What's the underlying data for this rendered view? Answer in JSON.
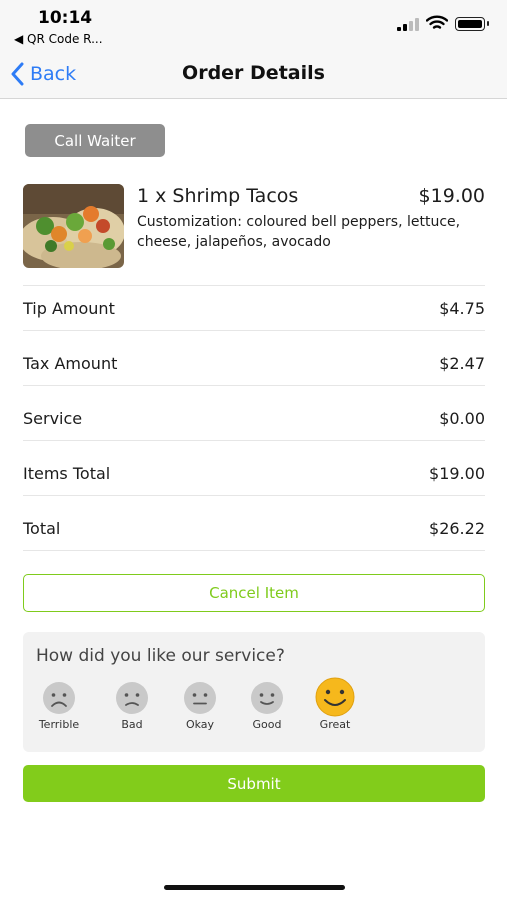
{
  "status_bar": {
    "time": "10:14",
    "back_app": "◀ QR Code R..."
  },
  "nav": {
    "back_label": "Back",
    "title": "Order Details"
  },
  "call_waiter_label": "Call Waiter",
  "item": {
    "name": "1 x Shrimp Tacos",
    "price": "$19.00",
    "customization": "Customization: coloured bell peppers, lettuce, cheese, jalapeños, avocado"
  },
  "summary": [
    {
      "label": "Tip Amount",
      "value": "$4.75"
    },
    {
      "label": "Tax Amount",
      "value": "$2.47"
    },
    {
      "label": "Service",
      "value": "$0.00"
    },
    {
      "label": "Items Total",
      "value": "$19.00"
    },
    {
      "label": "Total",
      "value": "$26.22"
    }
  ],
  "cancel_label": "Cancel Item",
  "feedback": {
    "question": "How did you like our service?",
    "ratings": [
      {
        "label": "Terrible",
        "icon": "terrible-face-icon"
      },
      {
        "label": "Bad",
        "icon": "bad-face-icon"
      },
      {
        "label": "Okay",
        "icon": "okay-face-icon"
      },
      {
        "label": "Good",
        "icon": "good-face-icon"
      },
      {
        "label": "Great",
        "icon": "great-face-icon"
      }
    ],
    "selected": "Great"
  },
  "submit_label": "Submit",
  "colors": {
    "accent_green": "#82cc1b",
    "link_blue": "#2e7cf6",
    "selected_face": "#f6b81c",
    "unselected_face": "#c9c9c9"
  }
}
